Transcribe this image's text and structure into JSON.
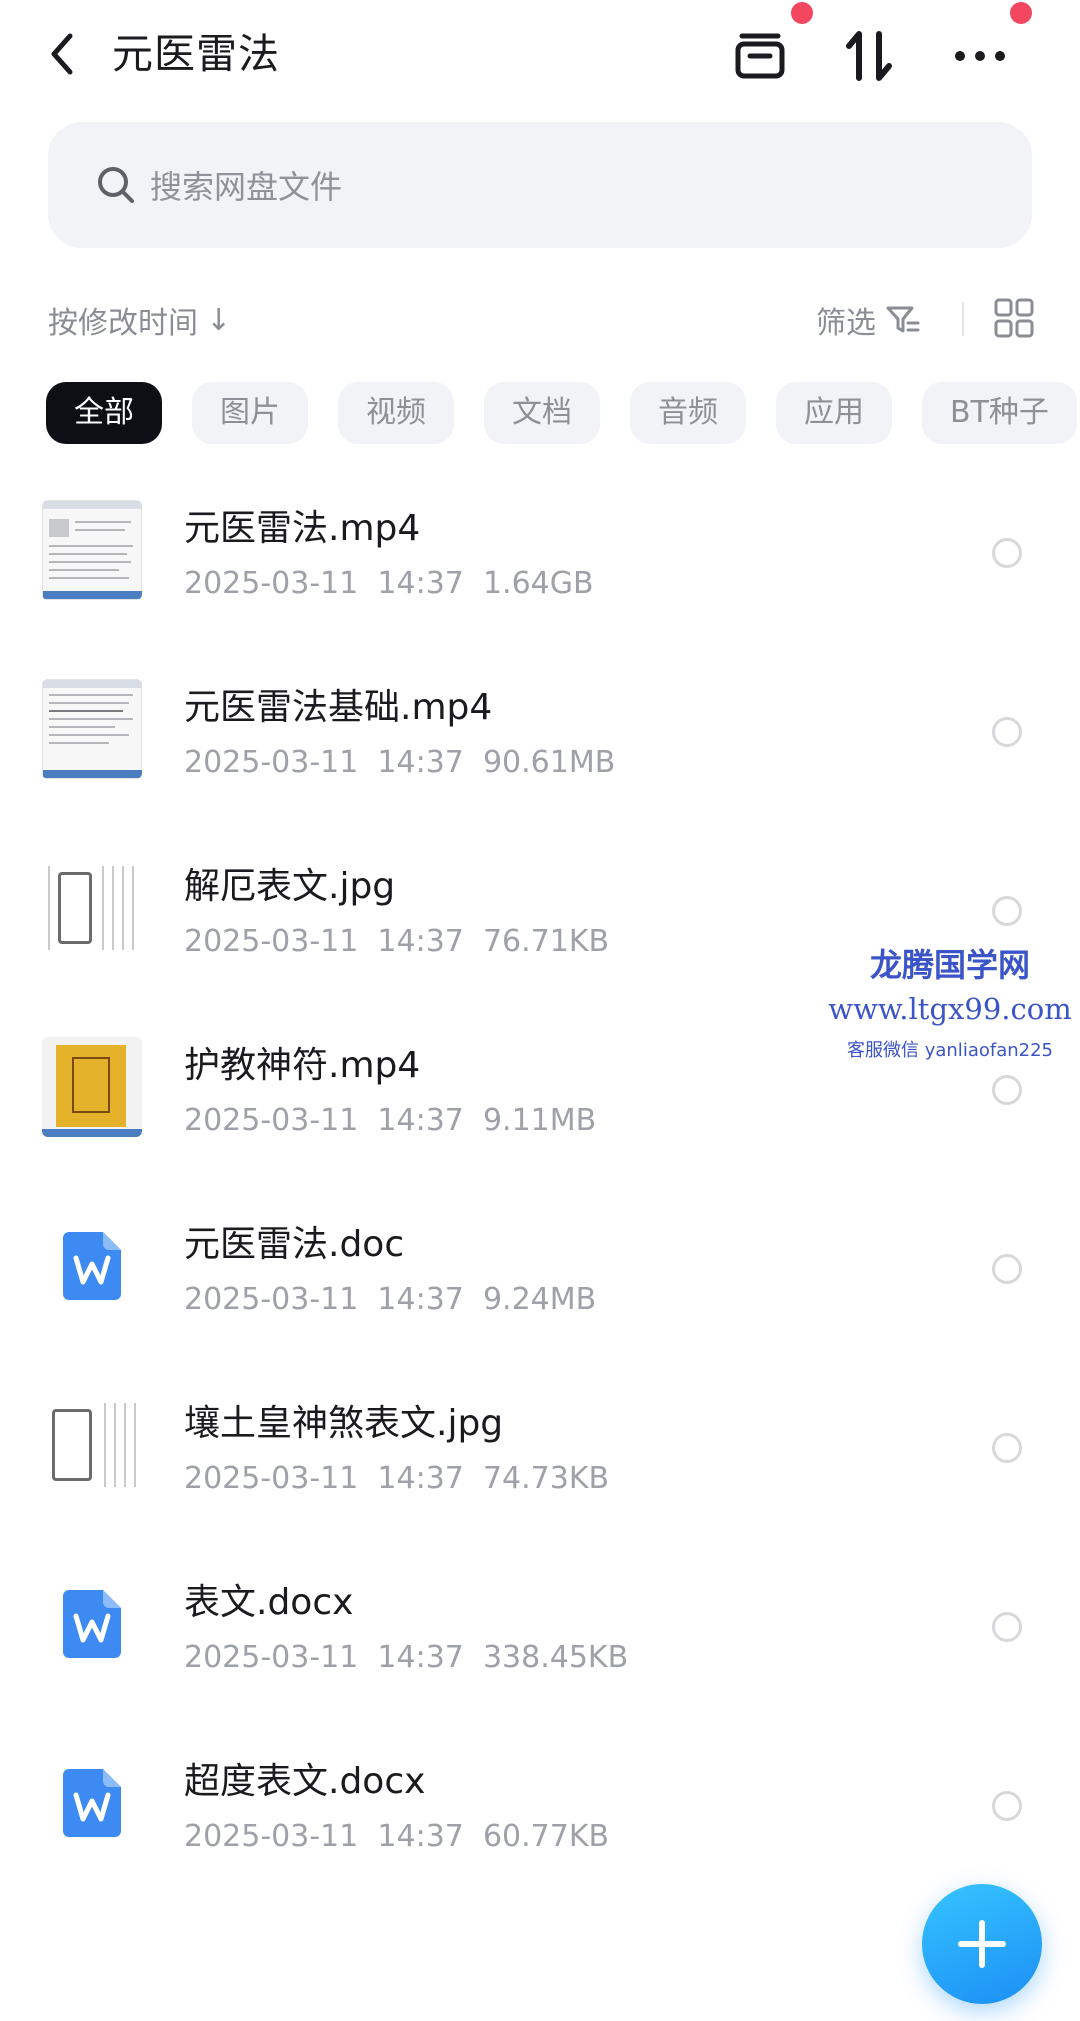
{
  "header": {
    "title": "元医雷法",
    "back_icon": "chevron-left-icon",
    "actions": [
      "archive-box-icon",
      "sort-arrows-icon",
      "more-dots-icon"
    ],
    "badge_color": "#f2475f"
  },
  "search": {
    "placeholder": "搜索网盘文件"
  },
  "sort": {
    "label": "按修改时间",
    "arrow": "↓"
  },
  "filter": {
    "label": "筛选"
  },
  "tabs": [
    {
      "label": "全部",
      "active": true
    },
    {
      "label": "图片",
      "active": false
    },
    {
      "label": "视频",
      "active": false
    },
    {
      "label": "文档",
      "active": false
    },
    {
      "label": "音频",
      "active": false
    },
    {
      "label": "应用",
      "active": false
    },
    {
      "label": "BT种子",
      "active": false
    }
  ],
  "files": [
    {
      "name": "元医雷法.mp4",
      "date": "2025-03-11  14:37",
      "size": "1.64GB",
      "thumb": "video-screenshot"
    },
    {
      "name": "元医雷法基础.mp4",
      "date": "2025-03-11  14:37",
      "size": "90.61MB",
      "thumb": "video-screenshot"
    },
    {
      "name": "解厄表文.jpg",
      "date": "2025-03-11  14:37",
      "size": "76.71KB",
      "thumb": "seal-image"
    },
    {
      "name": "护教神符.mp4",
      "date": "2025-03-11  14:37",
      "size": "9.11MB",
      "thumb": "yellow-talisman"
    },
    {
      "name": "元医雷法.doc",
      "date": "2025-03-11  14:37",
      "size": "9.24MB",
      "thumb": "word-icon"
    },
    {
      "name": "壤土皇神煞表文.jpg",
      "date": "2025-03-11  14:37",
      "size": "74.73KB",
      "thumb": "seal-image"
    },
    {
      "name": "表文.docx",
      "date": "2025-03-11  14:37",
      "size": "338.45KB",
      "thumb": "word-icon"
    },
    {
      "name": "超度表文.docx",
      "date": "2025-03-11  14:37",
      "size": "60.77KB",
      "thumb": "word-icon"
    }
  ],
  "watermark": {
    "line1": "龙腾国学网",
    "line2": "www.ltgx99.com",
    "line3": "客服微信 yanliaofan225",
    "color": "#3b54c8"
  },
  "fab": {
    "icon": "plus-icon",
    "color": "#1b8ff5"
  }
}
